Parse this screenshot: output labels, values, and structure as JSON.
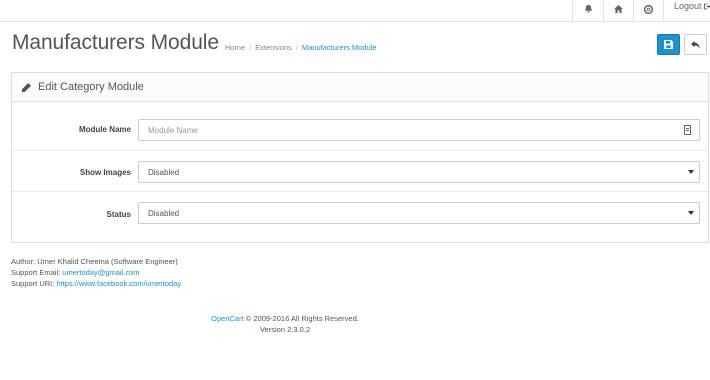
{
  "header": {
    "logout_label": "Logout"
  },
  "page": {
    "title": "Manufacturers Module",
    "breadcrumb": [
      "Home",
      "Extensions",
      "Manufacturers Module"
    ],
    "breadcrumb_separator": "/"
  },
  "colors": {
    "primary": "#1e91cf",
    "link": "#1e91cf"
  },
  "panel": {
    "title": "Edit Category Module",
    "fields": [
      {
        "label": "Module Name",
        "type": "text",
        "value": "",
        "placeholder": "Module Name"
      },
      {
        "label": "Show Images",
        "type": "select",
        "value": "Disabled"
      },
      {
        "label": "Status",
        "type": "select",
        "value": "Disabled"
      }
    ]
  },
  "info": {
    "author": "Author: Umer Khalid Cheema (Software Engineer)",
    "support_email_label": "Support Email:",
    "support_email": "umertoday@gmail.com",
    "support_uri_label": "Support URI:",
    "support_uri": "https://www.facebook.com/umertoday"
  },
  "footer": {
    "brand": "OpenCart",
    "copyright": "© 2009-2016 All Rights Reserved.",
    "version": "Version 2.3.0.2"
  },
  "icons": {
    "save": "save-icon",
    "back": "reply-icon",
    "bell": "bell-icon",
    "home": "home-icon",
    "help": "life-ring-icon",
    "logout": "sign-out-icon",
    "pencil": "pencil-icon"
  }
}
